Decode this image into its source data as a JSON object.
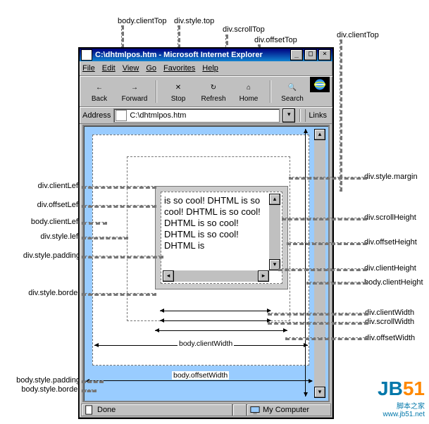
{
  "window": {
    "title": "C:\\dhtmlpos.htm - Microsoft Internet Explorer",
    "btn_min": "_",
    "btn_max": "□",
    "btn_close": "×",
    "menus": [
      "File",
      "Edit",
      "View",
      "Go",
      "Favorites",
      "Help"
    ],
    "toolbar": [
      {
        "name": "back",
        "label": "Back",
        "glyph": "←"
      },
      {
        "name": "forward",
        "label": "Forward",
        "glyph": "→"
      },
      {
        "name": "stop",
        "label": "Stop",
        "glyph": "✕"
      },
      {
        "name": "refresh",
        "label": "Refresh",
        "glyph": "↻"
      },
      {
        "name": "home",
        "label": "Home",
        "glyph": "⌂"
      },
      {
        "name": "search",
        "label": "Search",
        "glyph": "🔍"
      }
    ],
    "address_label": "Address",
    "address_value": "C:\\dhtmlpos.htm",
    "links_label": "Links",
    "dropdown_glyph": "▾",
    "status_done": "Done",
    "status_zone": "My Computer"
  },
  "content_text": "is so cool! DHTML is so cool! DHTML is so cool! DHTML is so cool! DHTML is so cool! DHTML is",
  "scroll_glyphs": {
    "up": "▴",
    "down": "▾",
    "left": "◂",
    "right": "▸"
  },
  "annotations": {
    "top": {
      "body_clientTop": "body.clientTop",
      "div_style_top": "div.style.top",
      "div_scrollTop": "div.scrollTop",
      "div_offsetTop": "div.offsetTop",
      "div_clientTop": "div.clientTop"
    },
    "left": {
      "div_clientLeft": "div.clientLeft",
      "div_offsetLeft": "div.offsetLeft",
      "body_clientLeft": "body.clientLeft",
      "div_style_left": "div.style.left",
      "div_style_padding": "div.style.padding",
      "div_style_border": "div.style.border",
      "body_style_padding": "body.style.padding",
      "body_style_border": "body.style.border"
    },
    "right": {
      "div_style_margin": "div.style.margin",
      "div_scrollHeight": "div.scrollHeight",
      "div_offsetHeight": "div.offsetHeight",
      "div_clientHeight": "div.clientHeight",
      "body_clientHeight": "body.clientHeight",
      "div_clientWidth": "div.clientWidth",
      "div_scrollWidth": "div.scrollWidth",
      "div_offsetWidth": "div.offsetWidth"
    },
    "bottom": {
      "body_clientWidth": "body.clientWidth",
      "body_offsetWidth": "body.offsetWidth"
    }
  },
  "watermark": {
    "brand1": "JB",
    "brand2": "51",
    "sub1": "脚本之家",
    "sub2": "www.jb51.net"
  }
}
